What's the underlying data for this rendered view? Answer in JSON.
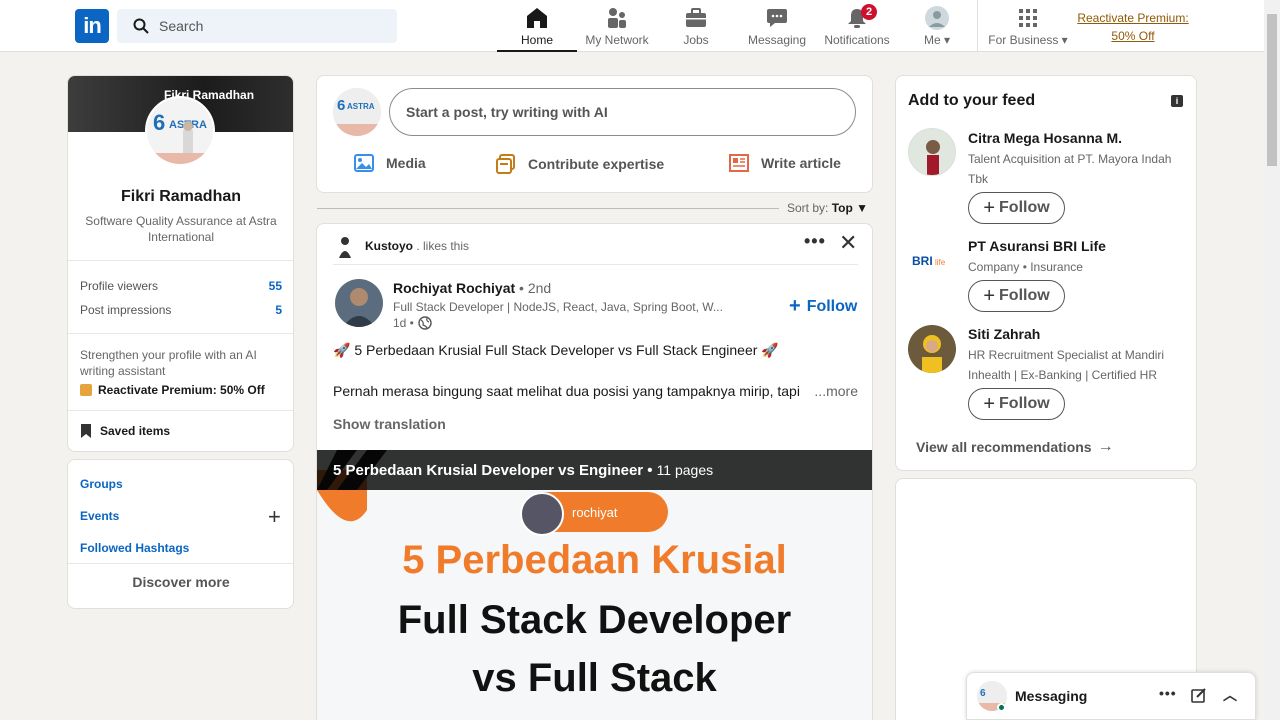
{
  "nav": {
    "logo_text": "in",
    "search_placeholder": "Search",
    "items": [
      {
        "label": "Home"
      },
      {
        "label": "My Network"
      },
      {
        "label": "Jobs"
      },
      {
        "label": "Messaging"
      },
      {
        "label": "Notifications",
        "badge": "2"
      },
      {
        "label": "Me"
      },
      {
        "label": "For Business"
      }
    ],
    "premium_line1": "Reactivate Premium:",
    "premium_line2": "50% Off"
  },
  "profile": {
    "cover_text": "Fikri Ramadhan",
    "name": "Fikri Ramadhan",
    "headline": "Software Quality Assurance at Astra International",
    "stats": [
      {
        "label": "Profile viewers",
        "value": "55"
      },
      {
        "label": "Post impressions",
        "value": "5"
      }
    ],
    "strengthen": "Strengthen your profile with an AI writing assistant",
    "reactivate": "Reactivate Premium: 50% Off",
    "saved": "Saved items"
  },
  "sidebar_links": {
    "groups": "Groups",
    "events": "Events",
    "hashtags": "Followed Hashtags",
    "discover": "Discover more"
  },
  "composer": {
    "placeholder": "Start a post, try writing with AI",
    "actions": [
      "Media",
      "Contribute expertise",
      "Write article"
    ]
  },
  "sort": {
    "label": "Sort by:",
    "value": "Top"
  },
  "post": {
    "social_actor": "Kustoyo",
    "social_action": ". likes this",
    "author": "Rochiyat Rochiyat",
    "degree": "• 2nd",
    "headline": "Full Stack Developer | NodeJS, React, Java, Spring Boot, W...",
    "time": "1d •",
    "follow": "Follow",
    "text1": "🚀 5 Perbedaan Krusial Full Stack Developer vs Full Stack Engineer 🚀",
    "text2": "Pernah merasa bingung saat melihat dua posisi yang tampaknya mirip, tapi",
    "more": "...more",
    "show_translation": "Show translation",
    "doc_title": "5 Perbedaan Krusial Developer vs Engineer •",
    "doc_pages": "11 pages",
    "doc_pill": "rochiyat",
    "doc_heading1": "5 Perbedaan Krusial",
    "doc_heading2": "Full Stack Developer",
    "doc_heading3": "vs Full Stack"
  },
  "feed": {
    "title": "Add to your feed",
    "recommendations": [
      {
        "name": "Citra Mega Hosanna M.",
        "sub": "Talent Acquisition at PT. Mayora Indah Tbk",
        "button": "Follow"
      },
      {
        "name": "PT Asuransi BRI Life",
        "sub": "Company • Insurance",
        "button": "Follow"
      },
      {
        "name": "Siti Zahrah",
        "sub": "HR Recruitment Specialist at Mandiri Inhealth | Ex-Banking | Certified HR Sta...",
        "button": "Follow"
      }
    ],
    "view_all": "View all recommendations"
  },
  "messaging": {
    "label": "Messaging"
  },
  "colors": {
    "brand": "#0a66c2",
    "badge": "#cb112d",
    "premium": "#915907",
    "accent_orange": "#f07c2b"
  }
}
